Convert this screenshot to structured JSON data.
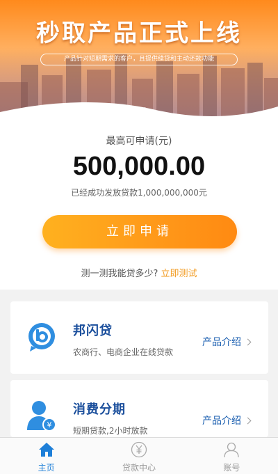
{
  "banner": {
    "title": "秒取产品正式上线",
    "subtitle": "产品针对短期需求的客户，且提供续贷和主动还款功能",
    "dots": 2,
    "active_dot": 0
  },
  "apply": {
    "max_label": "最高可申请(元)",
    "amount": "500,000.00",
    "issued_text": "已经成功发放贷款1,000,000,000元",
    "button_label": "立即申请",
    "test_prompt": "测一测我能贷多少?",
    "test_link": "立即测试"
  },
  "products": [
    {
      "name": "邦闪贷",
      "desc": "农商行、电商企业在线贷款",
      "intro_label": "产品介绍",
      "icon": "b-chat-icon"
    },
    {
      "name": "消费分期",
      "desc": "短期贷款,2小时放款",
      "intro_label": "产品介绍",
      "icon": "user-yen-icon"
    }
  ],
  "tabbar": {
    "items": [
      {
        "label": "主页",
        "icon": "home-icon",
        "active": true
      },
      {
        "label": "贷款中心",
        "icon": "yen-circle-icon",
        "active": false
      },
      {
        "label": "账号",
        "icon": "user-icon",
        "active": false
      }
    ]
  },
  "colors": {
    "accent_orange": "#ff9a1a",
    "link_orange": "#f29a1e",
    "product_blue": "#1b4f9c",
    "tab_active": "#1e7fd8"
  }
}
